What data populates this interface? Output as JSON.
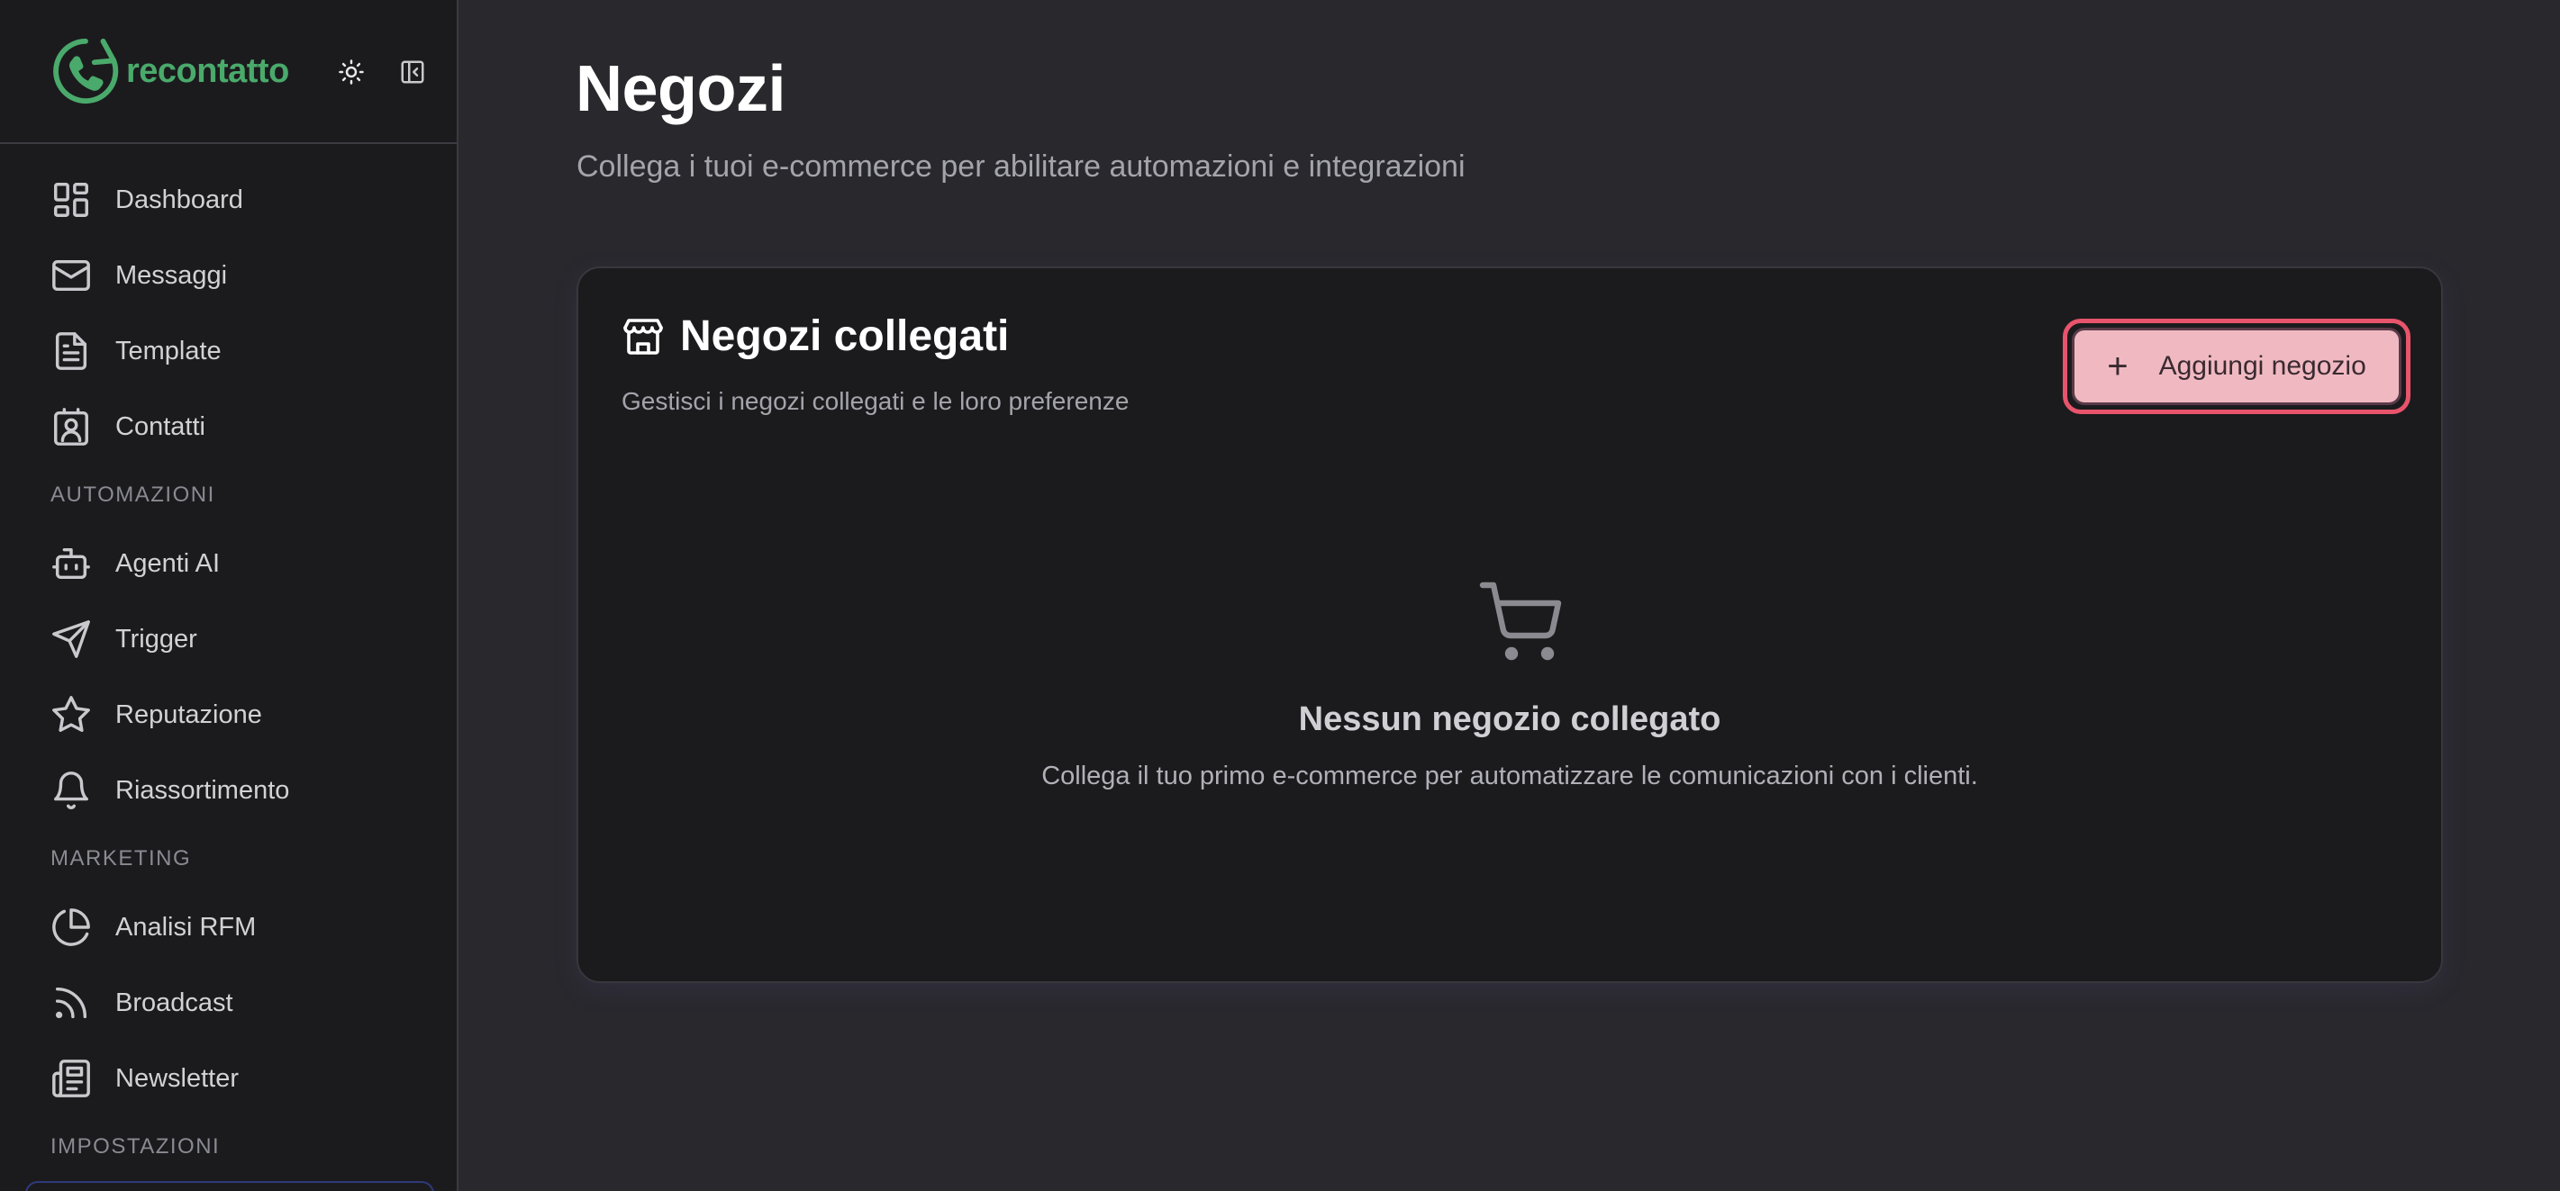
{
  "brand": {
    "name": "recontatto",
    "color": "#4aaa6b"
  },
  "sidebar": {
    "items_main": [
      {
        "label": "Dashboard",
        "icon": "dashboard-icon"
      },
      {
        "label": "Messaggi",
        "icon": "mail-icon"
      },
      {
        "label": "Template",
        "icon": "file-text-icon"
      },
      {
        "label": "Contatti",
        "icon": "contact-icon"
      }
    ],
    "section_automazioni": "AUTOMAZIONI",
    "items_automazioni": [
      {
        "label": "Agenti AI",
        "icon": "bot-icon"
      },
      {
        "label": "Trigger",
        "icon": "send-icon"
      },
      {
        "label": "Reputazione",
        "icon": "star-icon"
      },
      {
        "label": "Riassortimento",
        "icon": "bell-icon"
      }
    ],
    "section_marketing": "MARKETING",
    "items_marketing": [
      {
        "label": "Analisi RFM",
        "icon": "pie-chart-icon"
      },
      {
        "label": "Broadcast",
        "icon": "rss-icon"
      },
      {
        "label": "Newsletter",
        "icon": "newspaper-icon"
      }
    ],
    "section_impostazioni": "IMPOSTAZIONI"
  },
  "page": {
    "title": "Negozi",
    "subtitle": "Collega i tuoi e-commerce per abilitare automazioni e integrazioni"
  },
  "card": {
    "title": "Negozi collegati",
    "description": "Gestisci i negozi collegati e le loro preferenze",
    "add_button_label": "Aggiungi negozio",
    "empty_title": "Nessun negozio collegato",
    "empty_description": "Collega il tuo primo e-commerce per automatizzare le comunicazioni con i clienti."
  },
  "colors": {
    "accent_button": "#f0b9c2",
    "focus_ring": "#e8546c",
    "background": "#29282d",
    "sidebar": "#1b1b1e"
  }
}
